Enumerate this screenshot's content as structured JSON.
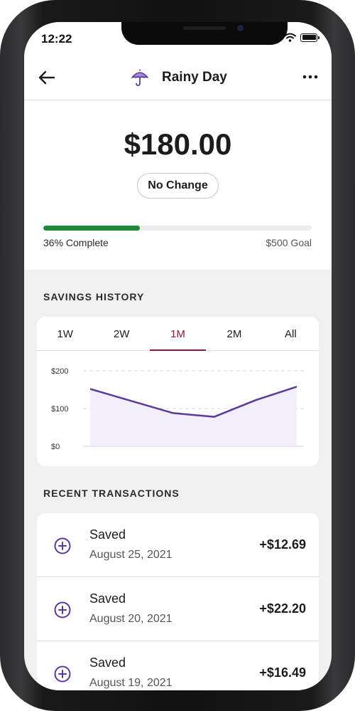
{
  "status_bar": {
    "time": "12:22"
  },
  "header": {
    "title": "Rainy Day",
    "icon": "umbrella-icon",
    "back_icon": "back-arrow-icon",
    "more_icon": "more-options-icon"
  },
  "balance": {
    "amount": "$180.00",
    "change_label": "No Change"
  },
  "progress": {
    "percent": 36,
    "complete_label": "36% Complete",
    "goal_label": "$500 Goal"
  },
  "savings_history": {
    "title": "SAVINGS HISTORY",
    "tabs": [
      "1W",
      "2W",
      "1M",
      "2M",
      "All"
    ],
    "active_tab": "1M"
  },
  "chart_data": {
    "type": "area",
    "y_tick_labels": [
      "$200",
      "$100",
      "$0"
    ],
    "ylim": [
      0,
      200
    ],
    "values": [
      152,
      120,
      88,
      78,
      122,
      158
    ],
    "grid": "dashed horizontal at $100 and $200",
    "line_color": "#5b3a9a",
    "fill_color": "#f2eefb"
  },
  "recent_transactions": {
    "title": "RECENT TRANSACTIONS",
    "items": [
      {
        "title": "Saved",
        "date": "August 25, 2021",
        "amount": "+$12.69"
      },
      {
        "title": "Saved",
        "date": "August 20, 2021",
        "amount": "+$22.20"
      },
      {
        "title": "Saved",
        "date": "August 19, 2021",
        "amount": "+$16.49"
      }
    ]
  },
  "colors": {
    "accent": "#5b3a9a",
    "progress": "#1f8a3c",
    "active_tab": "#8b1b34"
  }
}
